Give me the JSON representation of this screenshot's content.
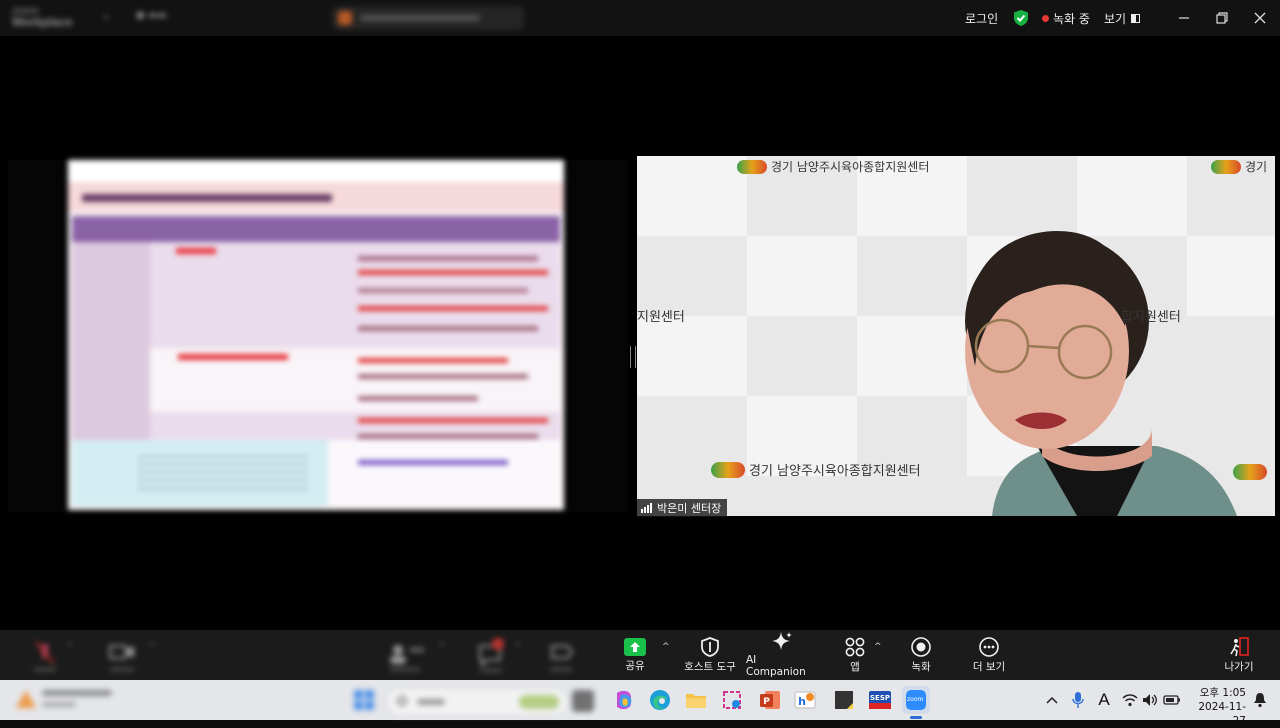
{
  "titlebar": {
    "login_label": "로그인",
    "recording_label": "녹화 중",
    "view_label": "보기"
  },
  "video": {
    "participant_name": "박은미 센터장",
    "banner_text": "경기 남양주시육아종합지원센터",
    "banner_partial_left": "지원센터",
    "banner_partial_right": "합지원센터",
    "banner_partial_topright": "경기"
  },
  "toolbar": {
    "share_label": "공유",
    "host_tools_label": "호스트 도구",
    "ai_companion_label": "AI Companion",
    "apps_label": "앱",
    "record_label": "녹화",
    "more_label": "더 보기",
    "leave_label": "나가기"
  },
  "taskbar": {
    "time": "오후 1:05",
    "date": "2024-11-27",
    "ime_label": "A",
    "sesp_label": "SESP",
    "zoom_label": "zoom"
  },
  "colors": {
    "share_green": "#19c04a",
    "record_dot": "#e53935",
    "shield_green": "#16b043",
    "leave_red": "#e02424"
  }
}
